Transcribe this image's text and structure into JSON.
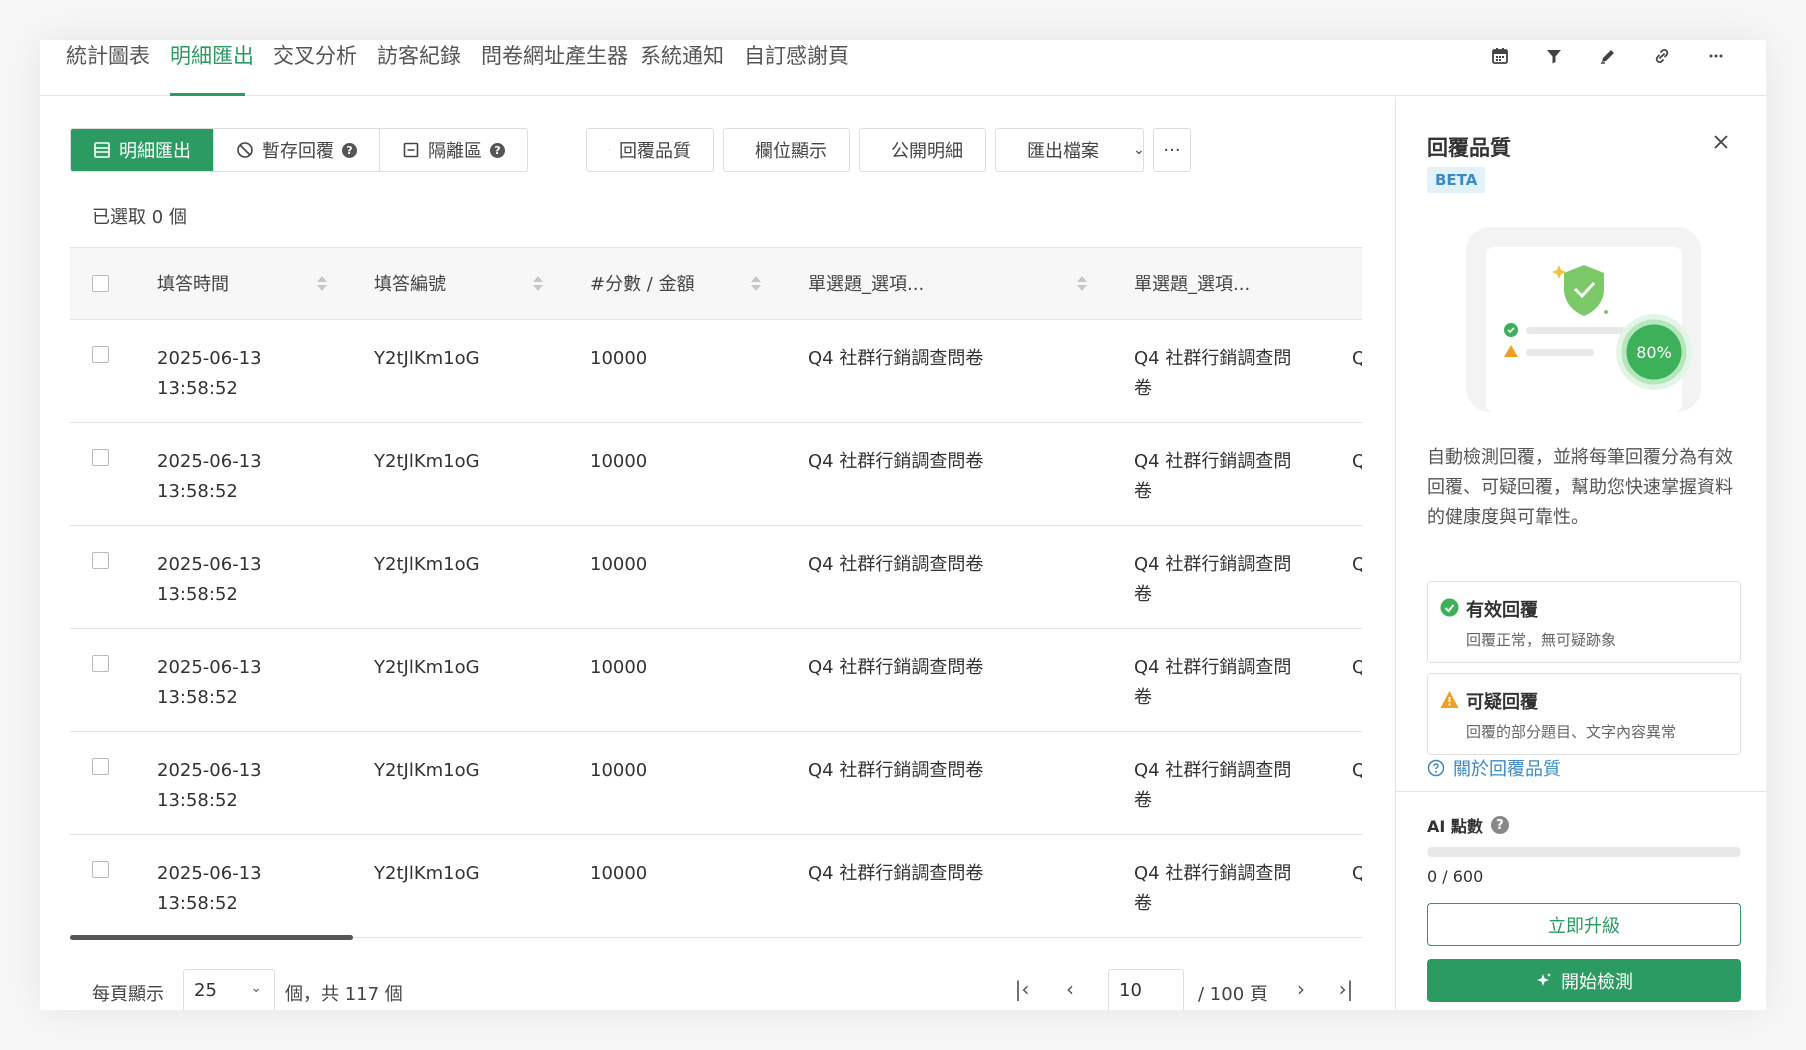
{
  "tabs": [
    {
      "label": "統計圖表"
    },
    {
      "label": "明細匯出"
    },
    {
      "label": "交叉分析"
    },
    {
      "label": "訪客紀錄"
    },
    {
      "label": "問卷網址產生器"
    },
    {
      "label": "系統通知"
    },
    {
      "label": "自訂感謝頁"
    }
  ],
  "top_icons": [
    "calendar-icon",
    "filter-icon",
    "edit-icon",
    "link-icon",
    "more-icon"
  ],
  "segments": {
    "details": "明細匯出",
    "drafts": "暫存回覆",
    "quarantine": "隔離區"
  },
  "toolbar": {
    "quality": "回覆品質",
    "columns": "欄位顯示",
    "share": "公開明細",
    "export": "匯出檔案",
    "more": "···"
  },
  "selected_count": "已選取 0 個",
  "table": {
    "columns": [
      "填答時間",
      "填答編號",
      "#分數 / 金額",
      "單選題_選項...",
      "單選題_選項..."
    ],
    "rows": [
      {
        "date": "2025-06-13",
        "time": "13:58:52",
        "id": "Y2tJlKm1oG",
        "score": "10000",
        "q1": "Q4 社群行銷調查問卷",
        "q2a": "Q4 社群行銷調查問",
        "q2b": "卷",
        "q3": "Q"
      },
      {
        "date": "2025-06-13",
        "time": "13:58:52",
        "id": "Y2tJlKm1oG",
        "score": "10000",
        "q1": "Q4 社群行銷調查問卷",
        "q2a": "Q4 社群行銷調查問",
        "q2b": "卷",
        "q3": "Q"
      },
      {
        "date": "2025-06-13",
        "time": "13:58:52",
        "id": "Y2tJlKm1oG",
        "score": "10000",
        "q1": "Q4 社群行銷調查問卷",
        "q2a": "Q4 社群行銷調查問",
        "q2b": "卷",
        "q3": "Q"
      },
      {
        "date": "2025-06-13",
        "time": "13:58:52",
        "id": "Y2tJlKm1oG",
        "score": "10000",
        "q1": "Q4 社群行銷調查問卷",
        "q2a": "Q4 社群行銷調查問",
        "q2b": "卷",
        "q3": "Q"
      },
      {
        "date": "2025-06-13",
        "time": "13:58:52",
        "id": "Y2tJlKm1oG",
        "score": "10000",
        "q1": "Q4 社群行銷調查問卷",
        "q2a": "Q4 社群行銷調查問",
        "q2b": "卷",
        "q3": "Q"
      },
      {
        "date": "2025-06-13",
        "time": "13:58:52",
        "id": "Y2tJlKm1oG",
        "score": "10000",
        "q1": "Q4 社群行銷調查問卷",
        "q2a": "Q4 社群行銷調查問",
        "q2b": "卷",
        "q3": "Q"
      }
    ]
  },
  "pager": {
    "per_page_label": "每頁顯示",
    "per_page": "25",
    "total": "個，共 117 個",
    "page": "10",
    "total_pages": "/ 100 頁"
  },
  "panel": {
    "title": "回覆品質",
    "badge": "BETA",
    "illus_percent": "80%",
    "description": "自動檢測回覆，並將每筆回覆分為有效回覆、可疑回覆，幫助您快速掌握資料的健康度與可靠性。",
    "valid_title": "有效回覆",
    "valid_sub": "回覆正常，無可疑跡象",
    "suspicious_title": "可疑回覆",
    "suspicious_sub": "回覆的部分題目、文字內容異常",
    "about": "關於回覆品質",
    "ai_label": "AI 點數",
    "ai_used_fraction": 0,
    "ai_count": "0 / 600",
    "upgrade": "立即升級",
    "start": "開始檢測"
  },
  "colors": {
    "accent": "#2c9b63",
    "link": "#3b8ac4",
    "warning": "#f0a020"
  }
}
